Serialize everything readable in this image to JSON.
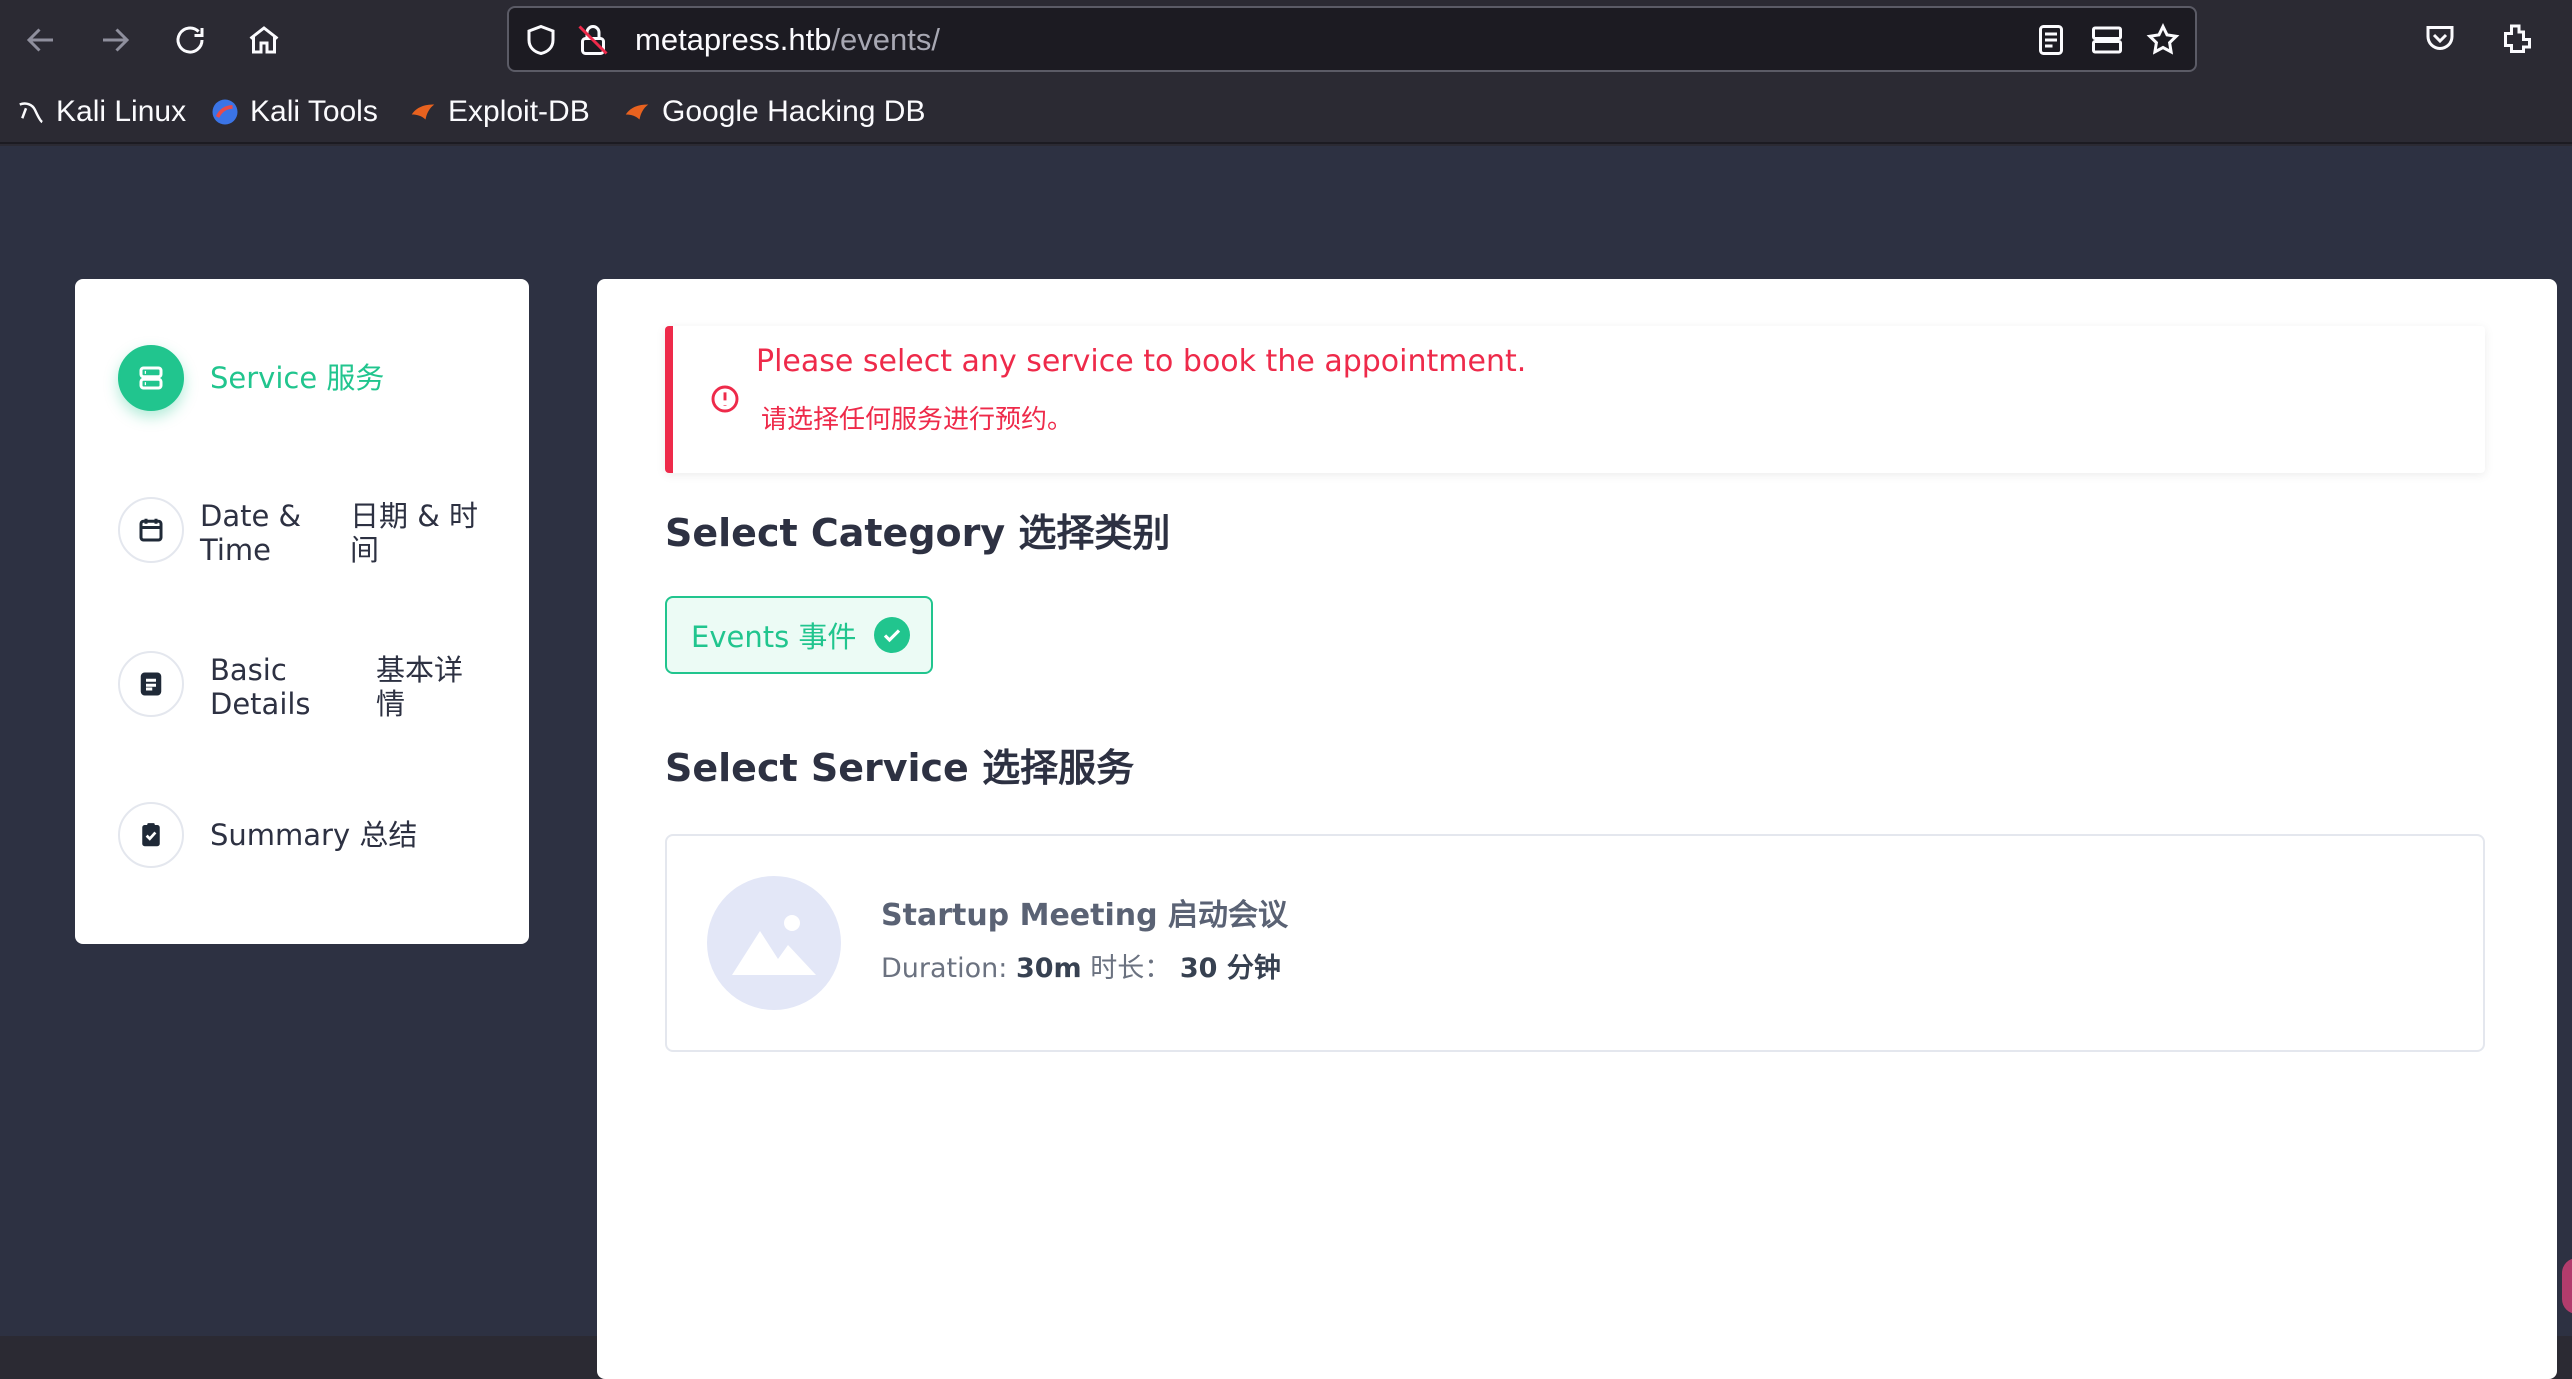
{
  "browser": {
    "url_host": "metapress.htb",
    "url_path": "/events/",
    "bookmarks": [
      {
        "label": "Kali Linux",
        "icon": "kali-dragon-icon"
      },
      {
        "label": "Kali Tools",
        "icon": "kali-tools-icon"
      },
      {
        "label": "Exploit-DB",
        "icon": "exploit-db-icon"
      },
      {
        "label": "Google Hacking DB",
        "icon": "ghdb-icon"
      }
    ]
  },
  "steps": [
    {
      "label": "Service 服务",
      "active": true,
      "icon": "server-icon"
    },
    {
      "label_en": "Date &\nTime",
      "label_zh": "日期 & 时\n间",
      "active": false,
      "icon": "calendar-icon"
    },
    {
      "label_en": "Basic\nDetails",
      "label_zh": "基本详\n情",
      "active": false,
      "icon": "document-icon"
    },
    {
      "label": "Summary 总结",
      "active": false,
      "icon": "clipboard-check-icon"
    }
  ],
  "alert": {
    "line1": "Please select any service to book the appointment.",
    "line2": "请选择任何服务进行预约。"
  },
  "category": {
    "title": "Select Category 选择类别",
    "chip_label": "Events 事件"
  },
  "service": {
    "title": "Select Service 选择服务",
    "name": "Startup Meeting 启动会议",
    "duration_label": "Duration:",
    "duration_value": "30m",
    "duration_zh_label": "时长：",
    "duration_zh_value": "30 分钟"
  },
  "colors": {
    "accent": "#21c58e",
    "alert": "#ee2a4a",
    "page_bg": "#2d3142"
  }
}
